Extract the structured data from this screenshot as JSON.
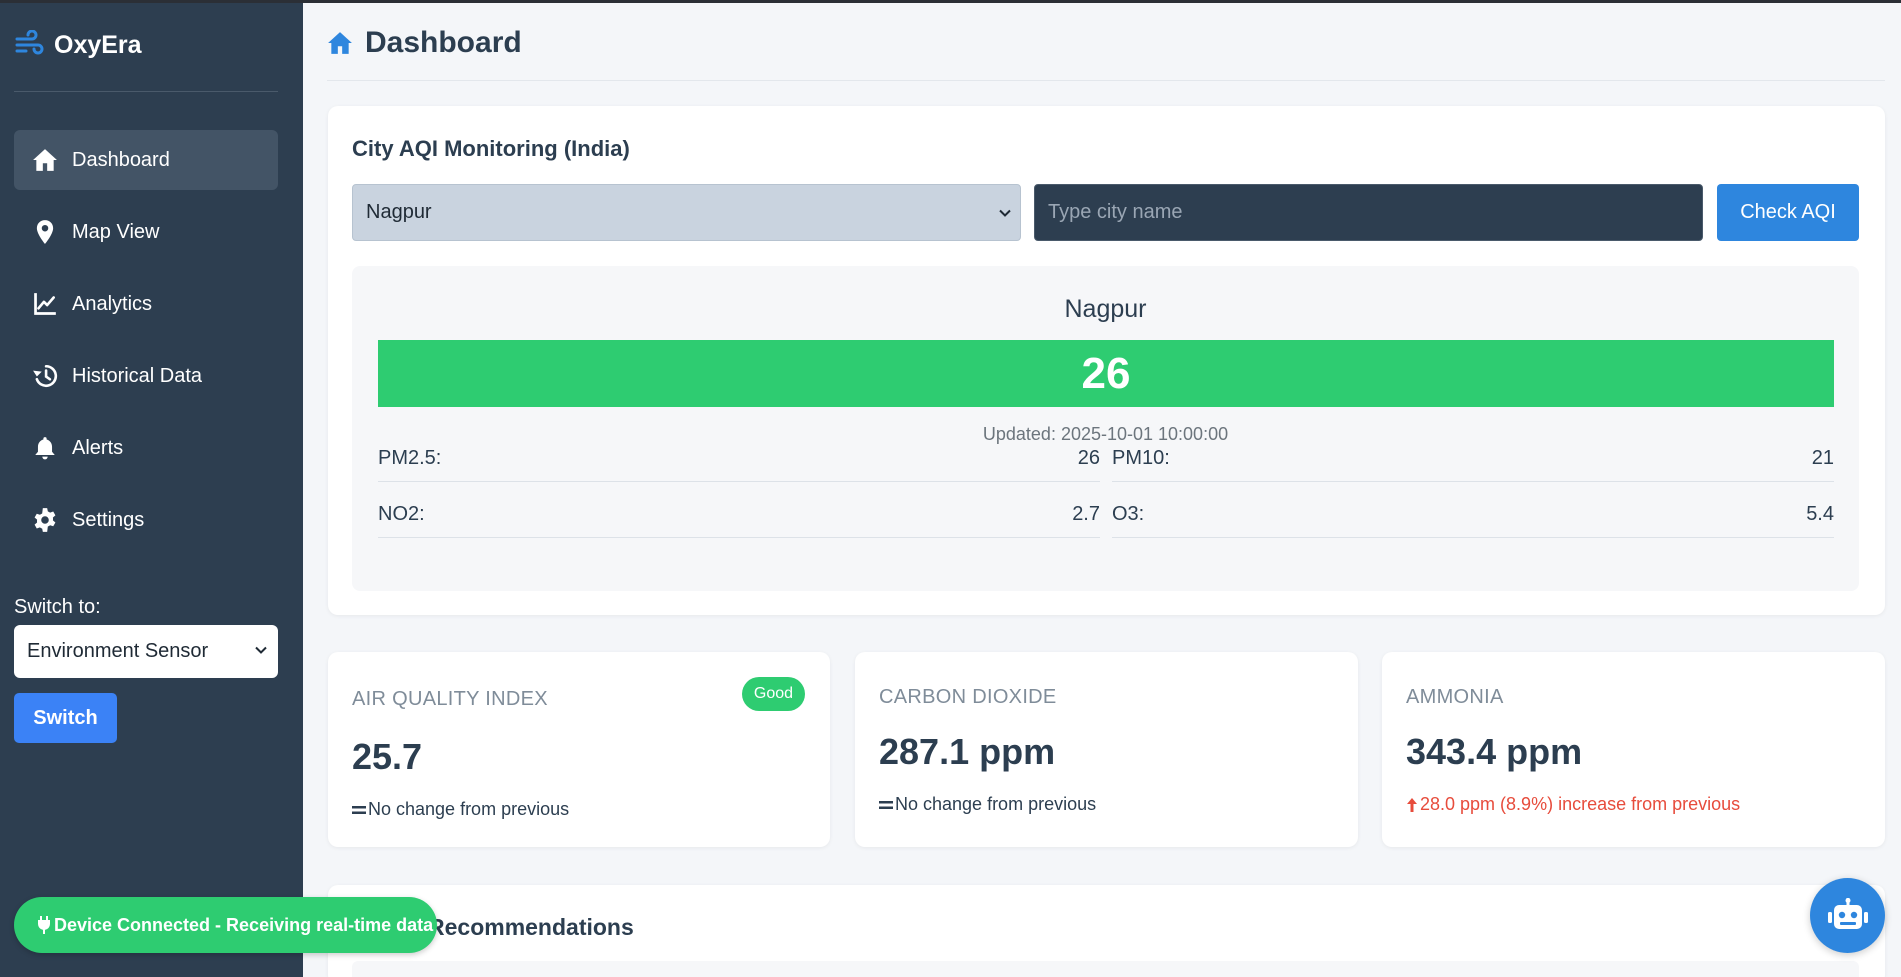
{
  "sidebar": {
    "brand": "OxyEra",
    "nav": [
      {
        "label": "Dashboard",
        "icon": "home-icon",
        "active": true
      },
      {
        "label": "Map View",
        "icon": "map-pin-icon"
      },
      {
        "label": "Analytics",
        "icon": "chart-line-icon"
      },
      {
        "label": "Historical Data",
        "icon": "history-icon"
      },
      {
        "label": "Alerts",
        "icon": "bell-icon"
      },
      {
        "label": "Settings",
        "icon": "gear-icon"
      }
    ],
    "switch_label": "Switch to:",
    "switch_value": "Environment Sensor",
    "switch_button": "Switch"
  },
  "header": {
    "title": "Dashboard"
  },
  "city_aqi": {
    "title": "City AQI Monitoring (India)",
    "selected_city": "Nagpur",
    "input_placeholder": "Type city name",
    "check_button": "Check AQI",
    "result": {
      "city": "Nagpur",
      "aqi": "26",
      "updated": "Updated: 2025-10-01 10:00:00",
      "pollutants": [
        {
          "label": "PM2.5:",
          "value": "26"
        },
        {
          "label": "PM10:",
          "value": "21"
        },
        {
          "label": "NO2:",
          "value": "2.7"
        },
        {
          "label": "O3:",
          "value": "5.4"
        }
      ]
    }
  },
  "metrics": [
    {
      "title": "AIR QUALITY INDEX",
      "badge": "Good",
      "value": "25.7",
      "change": "No change from previous",
      "trend": "flat"
    },
    {
      "title": "CARBON DIOXIDE",
      "value": "287.1 ppm",
      "change": "No change from previous",
      "trend": "flat"
    },
    {
      "title": "AMMONIA",
      "value": "343.4 ppm",
      "change": "28.0 ppm (8.9%) increase from previous",
      "trend": "up"
    }
  ],
  "recommendations": {
    "title": "Recommendations"
  },
  "connection": {
    "message": "Device Connected - Receiving real-time data"
  },
  "colors": {
    "sidebar": "#2d3e50",
    "accent": "#2e86de",
    "good": "#2ecc71",
    "increase": "#e74c3c",
    "switch_button": "#3b82f6"
  }
}
